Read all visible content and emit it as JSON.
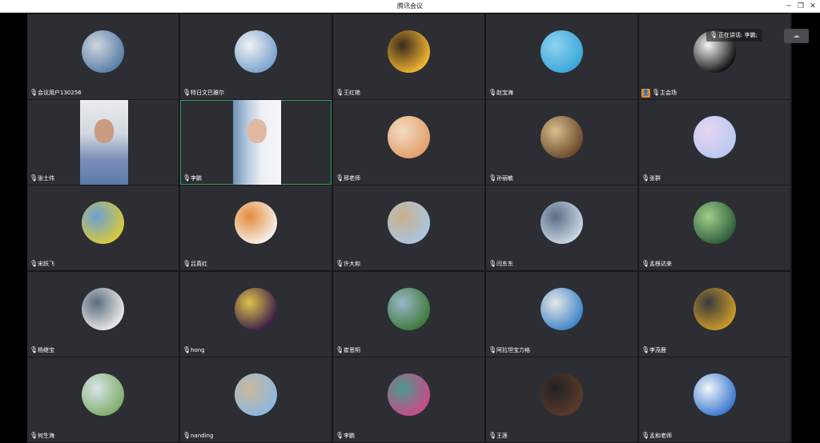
{
  "window": {
    "title": "腾讯会议",
    "minimize_icon": "minimize-icon",
    "restore_icon": "restore-icon",
    "close_icon": "close-icon"
  },
  "speaking": {
    "label": "正在讲话: 李鹏;"
  },
  "participants": [
    {
      "name": "会议用户130256",
      "avatar": [
        "#5b7ea8",
        "#cfd6de"
      ]
    },
    {
      "name": "特日文巴雅尔",
      "avatar": [
        "#7aa3cf",
        "#f2f2f2"
      ]
    },
    {
      "name": "王红艳",
      "avatar": [
        "#f2b531",
        "#3a2a1d"
      ]
    },
    {
      "name": "赵宝海",
      "avatar": [
        "#3aa7d9",
        "#8fd3f0"
      ]
    },
    {
      "name": "主会场",
      "avatar": [
        "#111111",
        "#f5f5f5"
      ],
      "host": true
    },
    {
      "name": "张士伟",
      "video": true
    },
    {
      "name": "李鹏",
      "video": true,
      "active": true
    },
    {
      "name": "邢老师",
      "avatar": [
        "#e3a06a",
        "#f2dcc4"
      ]
    },
    {
      "name": "孙丽敏",
      "avatar": [
        "#6b4a2b",
        "#d8bf8e"
      ]
    },
    {
      "name": "张群",
      "avatar": [
        "#b9c8f0",
        "#e8d6f2"
      ]
    },
    {
      "name": "宋跃飞",
      "avatar": [
        "#d9c93a",
        "#6aa0d6"
      ]
    },
    {
      "name": "吕真红",
      "avatar": [
        "#f4f1ea",
        "#e58a3c"
      ]
    },
    {
      "name": "许大和",
      "avatar": [
        "#a9c5e0",
        "#c9b08a"
      ]
    },
    {
      "name": "闫东东",
      "avatar": [
        "#c9d6e3",
        "#5a6e87"
      ]
    },
    {
      "name": "孟根达来",
      "avatar": [
        "#2f5e3b",
        "#9fd08a"
      ]
    },
    {
      "name": "杨继宝",
      "avatar": [
        "#e9e9e9",
        "#5a6b7c"
      ]
    },
    {
      "name": "hong",
      "avatar": [
        "#3a1f4a",
        "#e0c24a"
      ]
    },
    {
      "name": "崔思明",
      "avatar": [
        "#3f7a3a",
        "#9ab7c9"
      ]
    },
    {
      "name": "阿拉坦宝力格",
      "avatar": [
        "#3e86c9",
        "#e7e7e7"
      ]
    },
    {
      "name": "李茂鹿",
      "avatar": [
        "#c99a2a",
        "#3a3a3a"
      ]
    },
    {
      "name": "何生海",
      "avatar": [
        "#7fae6a",
        "#d9e4ea"
      ]
    },
    {
      "name": "nanding",
      "avatar": [
        "#8fb8e0",
        "#c9b89a"
      ]
    },
    {
      "name": "李鹏",
      "avatar": [
        "#c94b8a",
        "#4a9a8a"
      ]
    },
    {
      "name": "王莲",
      "avatar": [
        "#5a3a2a",
        "#222222"
      ]
    },
    {
      "name": "孟和老师",
      "avatar": [
        "#3a78d0",
        "#f2f6fa"
      ]
    }
  ]
}
